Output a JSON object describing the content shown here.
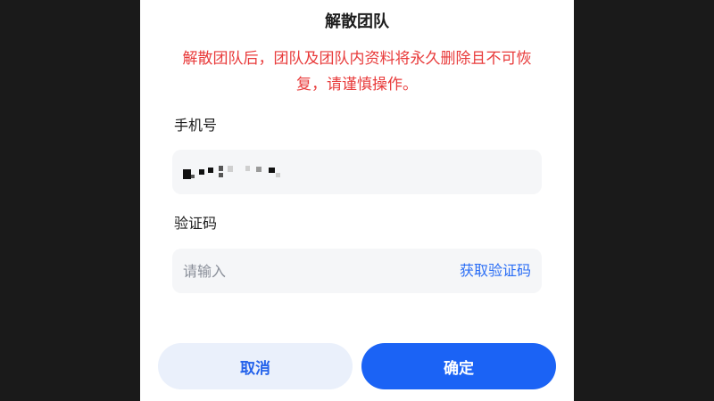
{
  "dialog": {
    "title": "解散团队",
    "warning": "解散团队后，团队及团队内资料将永久删除且不可恢复，请谨慎操作。"
  },
  "phone": {
    "label": "手机号"
  },
  "code": {
    "label": "验证码",
    "placeholder": "请输入",
    "value": "",
    "get_code_label": "获取验证码"
  },
  "actions": {
    "cancel_label": "取消",
    "confirm_label": "确定"
  },
  "colors": {
    "warning": "#e83a3a",
    "accent": "#1b63f5",
    "link": "#2a6df5",
    "cancel_bg": "#eaf0fb"
  }
}
